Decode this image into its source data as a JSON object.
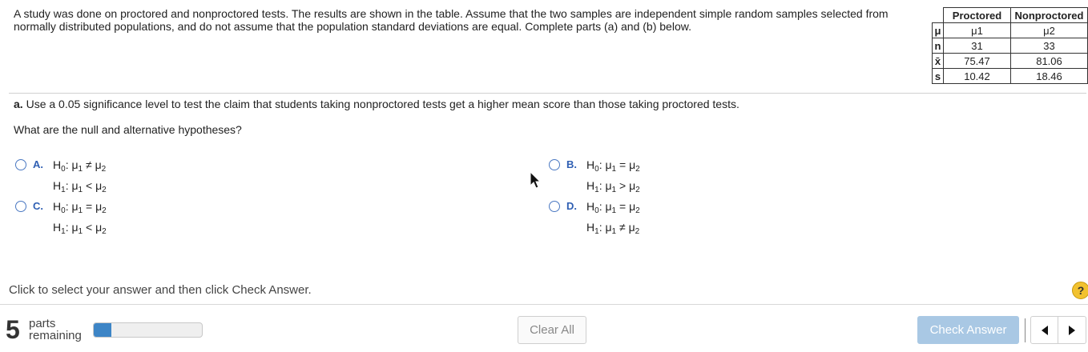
{
  "prompt": "A study was done on proctored and nonproctored tests. The results are shown in the table. Assume that the two samples are independent simple random samples selected from normally distributed populations, and do not assume that the population standard deviations are equal. Complete parts (a) and (b) below.",
  "table": {
    "headers": [
      "Proctored",
      "Nonproctored"
    ],
    "rows": [
      {
        "label": "μ",
        "values": [
          "μ1",
          "μ2"
        ]
      },
      {
        "label": "n",
        "values": [
          "31",
          "33"
        ]
      },
      {
        "label": "x̄",
        "values": [
          "75.47",
          "81.06"
        ]
      },
      {
        "label": "s",
        "values": [
          "10.42",
          "18.46"
        ]
      }
    ]
  },
  "part_a": {
    "prefix": "a.",
    "text": "Use a 0.05 significance level to test the claim that students taking nonproctored tests get a higher mean score than those taking proctored tests."
  },
  "question": "What are the null and alternative hypotheses?",
  "options": [
    {
      "letter": "A.",
      "h0_rel": "≠",
      "h1_rel": "<"
    },
    {
      "letter": "B.",
      "h0_rel": "=",
      "h1_rel": ">"
    },
    {
      "letter": "C.",
      "h0_rel": "=",
      "h1_rel": "<"
    },
    {
      "letter": "D.",
      "h0_rel": "=",
      "h1_rel": "≠"
    }
  ],
  "hint": "Click to select your answer and then click Check Answer.",
  "help_label": "?",
  "footer": {
    "parts_count": "5",
    "parts_line1": "parts",
    "parts_line2": "remaining",
    "progress_fraction": 0.16,
    "clear_label": "Clear All",
    "check_label": "Check Answer"
  },
  "colors": {
    "accent": "#2f5fb3",
    "progress": "#3d85c6",
    "check_button": "#a9c8e4",
    "help": "#f2c230"
  }
}
